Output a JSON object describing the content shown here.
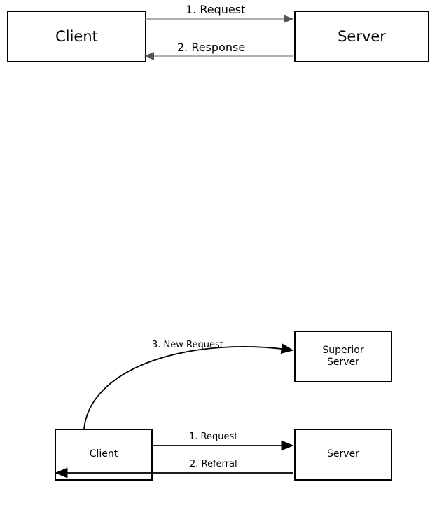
{
  "diagram_top": {
    "nodes": {
      "client": "Client",
      "server": "Server"
    },
    "arrows": {
      "request": "1. Request",
      "response": "2. Response"
    }
  },
  "diagram_bottom": {
    "nodes": {
      "client": "Client",
      "server": "Server",
      "superior": "Superior\nServer"
    },
    "arrows": {
      "request": "1. Request",
      "referral": "2. Referral",
      "new_request": "3. New Request"
    }
  }
}
